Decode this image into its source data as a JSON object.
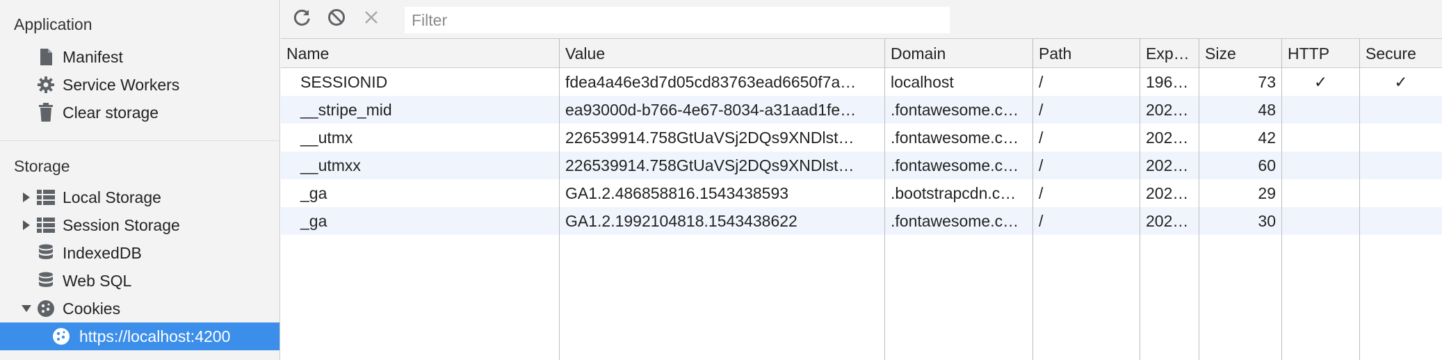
{
  "sidebar": {
    "application_title": "Application",
    "application_items": [
      {
        "label": "Manifest",
        "icon": "document-icon"
      },
      {
        "label": "Service Workers",
        "icon": "gear-icon"
      },
      {
        "label": "Clear storage",
        "icon": "trash-icon"
      }
    ],
    "storage_title": "Storage",
    "storage_items": [
      {
        "label": "Local Storage",
        "icon": "grid-icon",
        "expanded": false
      },
      {
        "label": "Session Storage",
        "icon": "grid-icon",
        "expanded": false
      },
      {
        "label": "IndexedDB",
        "icon": "database-icon"
      },
      {
        "label": "Web SQL",
        "icon": "database-icon"
      },
      {
        "label": "Cookies",
        "icon": "cookie-icon",
        "expanded": true
      }
    ],
    "selected_item": {
      "label": "https://localhost:4200",
      "icon": "cookie-icon"
    }
  },
  "toolbar": {
    "refresh_icon": "refresh-icon",
    "block_icon": "block-icon",
    "clear_icon": "close-icon",
    "filter_placeholder": "Filter"
  },
  "table": {
    "columns": [
      "Name",
      "Value",
      "Domain",
      "Path",
      "Exp…",
      "Size",
      "HTTP",
      "Secure"
    ],
    "rows": [
      {
        "name": "SESSIONID",
        "value": "fdea4a46e3d7d05cd83763ead6650f7a…",
        "domain": "localhost",
        "path": "/",
        "expires": "196…",
        "size": "73",
        "http": "✓",
        "secure": "✓"
      },
      {
        "name": "__stripe_mid",
        "value": "ea93000d-b766-4e67-8034-a31aad1fe…",
        "domain": ".fontawesome.c…",
        "path": "/",
        "expires": "202…",
        "size": "48",
        "http": "",
        "secure": ""
      },
      {
        "name": "__utmx",
        "value": "226539914.758GtUaVSj2DQs9XNDlst…",
        "domain": ".fontawesome.c…",
        "path": "/",
        "expires": "202…",
        "size": "42",
        "http": "",
        "secure": ""
      },
      {
        "name": "__utmxx",
        "value": "226539914.758GtUaVSj2DQs9XNDlst…",
        "domain": ".fontawesome.c…",
        "path": "/",
        "expires": "202…",
        "size": "60",
        "http": "",
        "secure": ""
      },
      {
        "name": "_ga",
        "value": "GA1.2.486858816.1543438593",
        "domain": ".bootstrapcdn.c…",
        "path": "/",
        "expires": "202…",
        "size": "29",
        "http": "",
        "secure": ""
      },
      {
        "name": "_ga",
        "value": "GA1.2.1992104818.1543438622",
        "domain": ".fontawesome.c…",
        "path": "/",
        "expires": "202…",
        "size": "30",
        "http": "",
        "secure": ""
      }
    ]
  },
  "colors": {
    "accent": "#3b8eea",
    "row_alt": "#f0f5fd",
    "panel": "#f3f3f3"
  }
}
